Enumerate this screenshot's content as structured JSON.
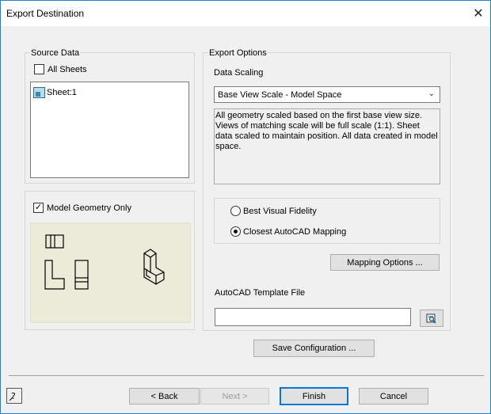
{
  "window": {
    "title": "Export Destination"
  },
  "source_data": {
    "label": "Source Data",
    "all_sheets_label": "All Sheets",
    "all_sheets_checked": false,
    "sheets": [
      "Sheet:1"
    ]
  },
  "model_geometry": {
    "label": "Model Geometry Only",
    "checked": true
  },
  "export_options": {
    "label": "Export Options",
    "data_scaling_label": "Data Scaling",
    "data_scaling_value": "Base View Scale - Model Space",
    "description": "All geometry scaled based on the first base view size. Views of matching scale will be full scale (1:1). Sheet data scaled to maintain position. All data created in model space.",
    "radio_options": [
      {
        "label": "Best Visual Fidelity",
        "selected": false
      },
      {
        "label": "Closest AutoCAD Mapping",
        "selected": true
      }
    ],
    "mapping_button": "Mapping Options ...",
    "template_label": "AutoCAD Template File",
    "template_value": "",
    "browse_icon": "folder-search-icon"
  },
  "save_configuration": "Save Configuration ...",
  "footer": {
    "help_icon": "help-icon",
    "back": "< Back",
    "next": "Next >",
    "finish": "Finish",
    "cancel": "Cancel"
  }
}
